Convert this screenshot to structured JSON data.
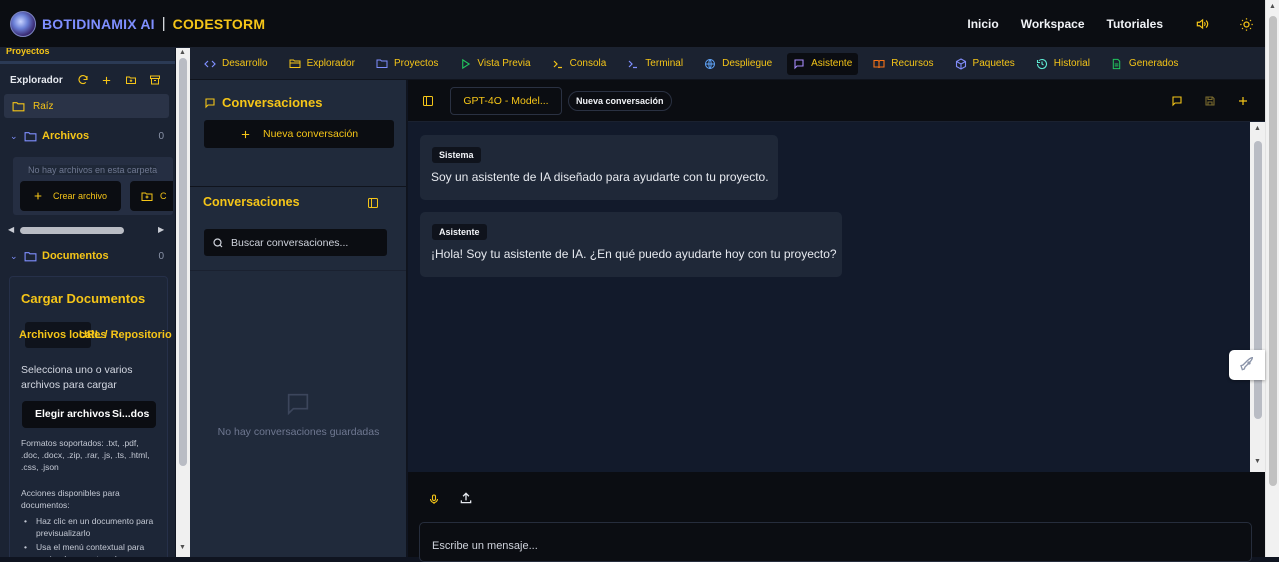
{
  "brand": {
    "name": "BOTIDINAMIX AI",
    "separator": "|",
    "product": "CODESTORM"
  },
  "topnav": {
    "links": [
      "Inicio",
      "Workspace",
      "Tutoriales"
    ],
    "sound_icon": "speaker-icon",
    "theme_icon": "sun-icon"
  },
  "colors": {
    "accent": "#f5c518",
    "brand": "#7f8fff",
    "dark_bg": "#0b0d12",
    "panel_bg": "#1b2333"
  },
  "left": {
    "section_title": "Proyectos",
    "explorer_label": "Explorador",
    "root_label": "Raíz",
    "folders": [
      {
        "name": "Archivos",
        "count": "0"
      },
      {
        "name": "Documentos",
        "count": "0"
      }
    ],
    "empty_msg": "No hay archivos en esta carpeta",
    "create_file": "Crear archivo",
    "create_folder_cut": "C",
    "docs": {
      "title": "Cargar Documentos",
      "tab_local": "Archivos locales",
      "tab_url": "URL / Repositorio",
      "desc": "Selecciona uno o varios archivos para cargar",
      "choose_btn": "Elegir archivos",
      "choose_status": "Si...dos",
      "formats": "Formatos soportados: .txt, .pdf, .doc, .docx, .zip, .rar, .js, .ts, .html, .css, .json",
      "actions_title": "Acciones disponibles para documentos:",
      "actions": [
        "Haz clic en un documento para previsualizarlo",
        "Usa el menú contextual para enviar documentos al"
      ]
    }
  },
  "tabs": [
    {
      "label": "Desarrollo",
      "icon": "code-icon"
    },
    {
      "label": "Explorador",
      "icon": "folder-open-icon"
    },
    {
      "label": "Proyectos",
      "icon": "folder-icon"
    },
    {
      "label": "Vista Previa",
      "icon": "play-icon"
    },
    {
      "label": "Consola",
      "icon": "terminal-icon"
    },
    {
      "label": "Terminal",
      "icon": "terminal-icon"
    },
    {
      "label": "Despliegue",
      "icon": "globe-icon"
    },
    {
      "label": "Asistente",
      "icon": "chat-icon"
    },
    {
      "label": "Recursos",
      "icon": "book-icon"
    },
    {
      "label": "Paquetes",
      "icon": "package-icon"
    },
    {
      "label": "Historial",
      "icon": "history-icon"
    },
    {
      "label": "Generados",
      "icon": "file-icon"
    }
  ],
  "active_tab": "Asistente",
  "conversations": {
    "title": "Conversaciones",
    "new_button": "Nueva conversación",
    "list_title": "Conversaciones",
    "search_placeholder": "Buscar conversaciones...",
    "empty": "No hay conversaciones guardadas"
  },
  "chat": {
    "model": "GPT-4O - Model...",
    "session_badge": "Nueva conversación",
    "messages": [
      {
        "role": "Sistema",
        "text": "Soy un asistente de IA diseñado para ayudarte con tu proyecto."
      },
      {
        "role": "Asistente",
        "text": "¡Hola! Soy tu asistente de IA. ¿En qué puedo ayudarte hoy con tu proyecto?"
      }
    ],
    "input_placeholder": "Escribe un mensaje..."
  }
}
